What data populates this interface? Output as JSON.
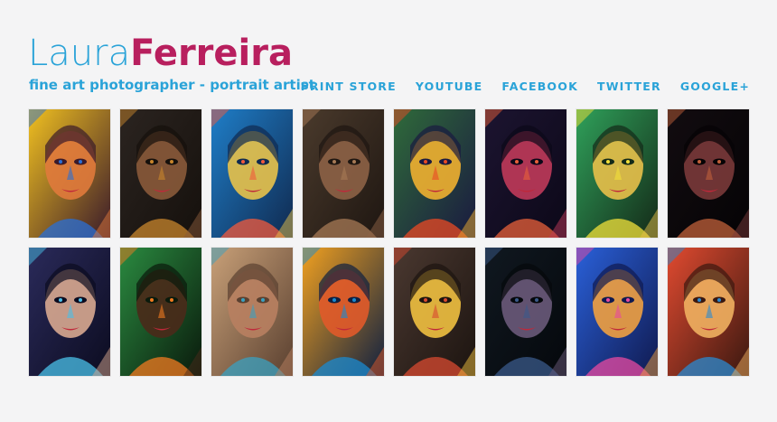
{
  "header": {
    "first_name": "Laura",
    "last_name": "Ferreira",
    "tagline": "fine art photographer - portrait artist"
  },
  "nav": [
    {
      "label": "PRINT STORE"
    },
    {
      "label": "YOUTUBE"
    },
    {
      "label": "FACEBOOK"
    },
    {
      "label": "TWITTER"
    },
    {
      "label": "GOOGLE+"
    }
  ],
  "colors": {
    "first_name": "#2aa3d8",
    "last_name": "#b81f5e",
    "nav": "#2aa3d8",
    "background": "#f4f4f5"
  },
  "gallery": [
    {
      "bg": "#f0c020",
      "accent": "#2a6fd6",
      "face": "#e07a3c",
      "dark": "#3a1a2a"
    },
    {
      "bg": "#2b2420",
      "accent": "#c8852c",
      "face": "#8a5a3a",
      "dark": "#15100c"
    },
    {
      "bg": "#1f7ec8",
      "accent": "#f25a3c",
      "face": "#e8c24a",
      "dark": "#102a50"
    },
    {
      "bg": "#4a3a2c",
      "accent": "#a77a55",
      "face": "#8d6246",
      "dark": "#1e1611"
    },
    {
      "bg": "#2f6a3a",
      "accent": "#e94a24",
      "face": "#f0b030",
      "dark": "#1a1a40"
    },
    {
      "bg": "#1c1430",
      "accent": "#e8603a",
      "face": "#c03a5a",
      "dark": "#0c0818"
    },
    {
      "bg": "#2fa05a",
      "accent": "#f2e03a",
      "face": "#e8c04a",
      "dark": "#142a18"
    },
    {
      "bg": "#120c10",
      "accent": "#c0603a",
      "face": "#7a3a3a",
      "dark": "#050305"
    },
    {
      "bg": "#2a2a5a",
      "accent": "#4ac0e8",
      "face": "#d8a890",
      "dark": "#0c0c20"
    },
    {
      "bg": "#2a8a40",
      "accent": "#f07a20",
      "face": "#4a2a1a",
      "dark": "#0a1a0c"
    },
    {
      "bg": "#c8a078",
      "accent": "#3aa0c0",
      "face": "#b88060",
      "dark": "#5a4030"
    },
    {
      "bg": "#f0a020",
      "accent": "#1a8ad0",
      "face": "#e05a2a",
      "dark": "#102040"
    },
    {
      "bg": "#4a3830",
      "accent": "#d84a30",
      "face": "#f0c040",
      "dark": "#1c1410"
    },
    {
      "bg": "#101820",
      "accent": "#3a5a8a",
      "face": "#6a5a7a",
      "dark": "#05080c"
    },
    {
      "bg": "#2a60d8",
      "accent": "#e84aa0",
      "face": "#f0a040",
      "dark": "#101a50"
    },
    {
      "bg": "#e04a30",
      "accent": "#2a8ad0",
      "face": "#f0b060",
      "dark": "#3a1810"
    }
  ]
}
